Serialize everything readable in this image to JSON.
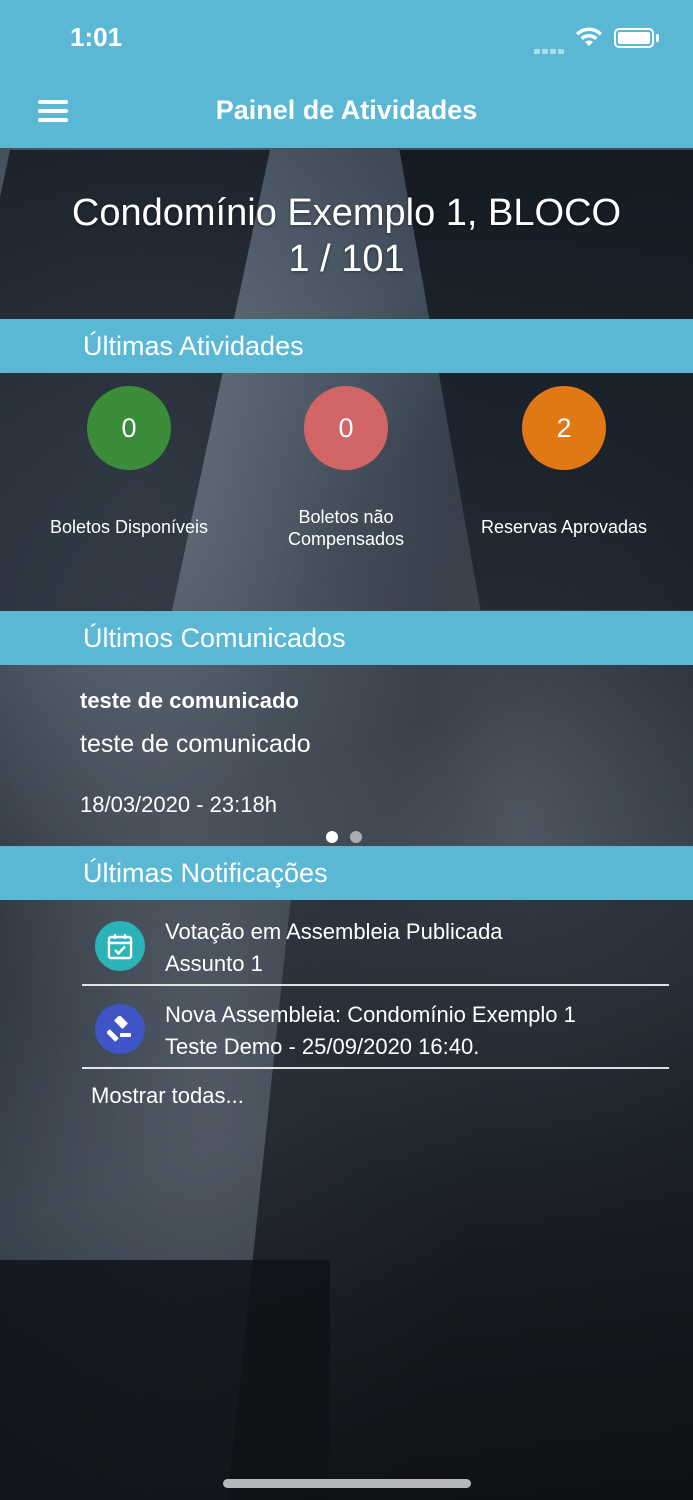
{
  "status_bar": {
    "time": "1:01"
  },
  "nav": {
    "title": "Painel de Atividades",
    "menu_icon": "hamburger-menu-icon"
  },
  "header": {
    "condo_line1": "Condomínio Exemplo 1, BLOCO",
    "condo_line2": "1 / 101"
  },
  "activities": {
    "title": "Últimas Atividades",
    "items": [
      {
        "count": "0",
        "label_line1": "Boletos Disponíveis",
        "label_line2": "",
        "color": "#3b8d3a"
      },
      {
        "count": "0",
        "label_line1": "Boletos não",
        "label_line2": "Compensados",
        "color": "#d26565"
      },
      {
        "count": "2",
        "label_line1": "Reservas Aprovadas",
        "label_line2": "",
        "color": "#e07813"
      }
    ]
  },
  "communications": {
    "title": "Últimos Comunicados",
    "item": {
      "title": "teste de comunicado",
      "body": "teste de comunicado",
      "date": "18/03/2020 - 23:18h"
    },
    "page_count": 2,
    "current_page": 1
  },
  "notifications": {
    "title": "Últimas Notificações",
    "items": [
      {
        "line1": "Votação em Assembleia Publicada",
        "line2": "Assunto 1",
        "icon": "calendar-check-icon",
        "icon_color": "#2ab3b8"
      },
      {
        "line1": "Nova Assembleia: Condomínio Exemplo 1",
        "line2": "Teste Demo - 25/09/2020 16:40.",
        "icon": "gavel-icon",
        "icon_color": "#3f55c6"
      }
    ],
    "show_all": "Mostrar todas..."
  },
  "colors": {
    "accent": "#5bb8d4"
  }
}
